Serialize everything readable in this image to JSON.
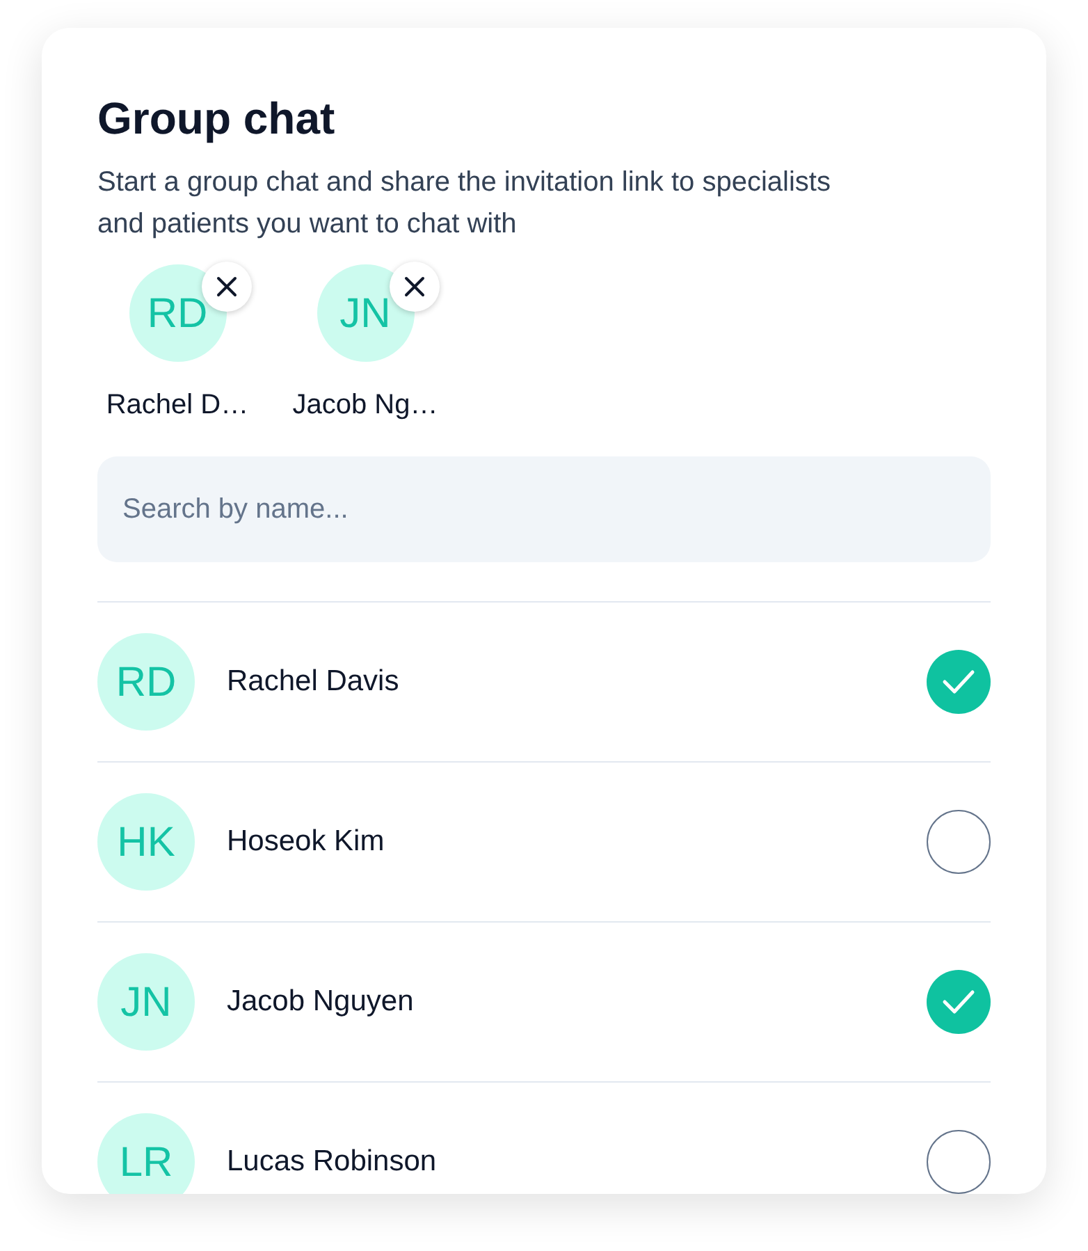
{
  "title": "Group chat",
  "subtitle": "Start a group chat and share the invitation link to specialists and patients you want to chat with",
  "selected_people": [
    {
      "initials": "RD",
      "name": "Rachel D…"
    },
    {
      "initials": "JN",
      "name": "Jacob Ng…"
    }
  ],
  "search": {
    "placeholder": "Search by name..."
  },
  "contacts": [
    {
      "initials": "RD",
      "name": "Rachel Davis",
      "checked": true
    },
    {
      "initials": "HK",
      "name": "Hoseok Kim",
      "checked": false
    },
    {
      "initials": "JN",
      "name": "Jacob Nguyen",
      "checked": true
    },
    {
      "initials": "LR",
      "name": "Lucas Robinson",
      "checked": false
    }
  ]
}
